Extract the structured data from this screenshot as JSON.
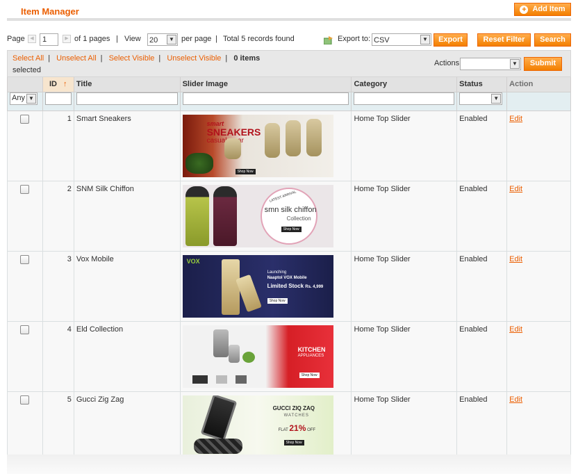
{
  "header": {
    "title": "Item Manager",
    "add_label": "Add Item"
  },
  "pager": {
    "page_label": "Page",
    "page_value": "1",
    "of_pages": "of 1 pages",
    "view_label": "View",
    "per_page_value": "20",
    "per_page_label": "per page",
    "total": "Total 5 records found",
    "export_label": "Export to:",
    "export_value": "CSV"
  },
  "buttons": {
    "export": "Export",
    "reset": "Reset Filter",
    "search": "Search",
    "submit": "Submit"
  },
  "mass": {
    "select_all": "Select All",
    "unselect_all": "Unselect All",
    "select_visible": "Select Visible",
    "unselect_visible": "Unselect Visible",
    "count": "0 items",
    "selected": "selected",
    "actions_label": "Actions"
  },
  "columns": {
    "id": "ID",
    "title": "Title",
    "image": "Slider Image",
    "category": "Category",
    "status": "Status",
    "action": "Action"
  },
  "filter": {
    "any": "Any"
  },
  "rows": [
    {
      "id": "1",
      "title": "Smart Sneakers",
      "category": "Home Top Slider",
      "status": "Enabled",
      "action": "Edit",
      "slide": {
        "line1": "smart",
        "line2": "SNEAKERS",
        "line3": "casual wear",
        "cta": "Shop Now"
      }
    },
    {
      "id": "2",
      "title": "SNM Silk Chiffon",
      "category": "Home Top Slider",
      "status": "Enabled",
      "action": "Edit",
      "slide": {
        "line1": "LATEST ARRIVAL",
        "line2": "smn silk chiffon",
        "line3": "Collection",
        "cta": "Shop Now"
      }
    },
    {
      "id": "3",
      "title": "Vox Mobile",
      "category": "Home Top Slider",
      "status": "Enabled",
      "action": "Edit",
      "slide": {
        "brand": "VOX",
        "line1": "Launching",
        "line2": "Naaptol VOX Mobile",
        "line3": "Limited Stock",
        "price": "Rs. 4,999",
        "cta": "Shop Now"
      }
    },
    {
      "id": "4",
      "title": "Eld Collection",
      "category": "Home Top Slider",
      "status": "Enabled",
      "action": "Edit",
      "slide": {
        "line1": "KITCHEN",
        "line2": "APPLIANCES",
        "cta": "Shop Now"
      }
    },
    {
      "id": "5",
      "title": "Gucci Zig Zag",
      "category": "Home Top Slider",
      "status": "Enabled",
      "action": "Edit",
      "slide": {
        "line1": "GUCCI ZIQ ZAQ",
        "line2": "WATCHES",
        "line3": "FLAT",
        "pct": "21%",
        "off": "OFF",
        "cta": "Shop Now"
      }
    }
  ]
}
